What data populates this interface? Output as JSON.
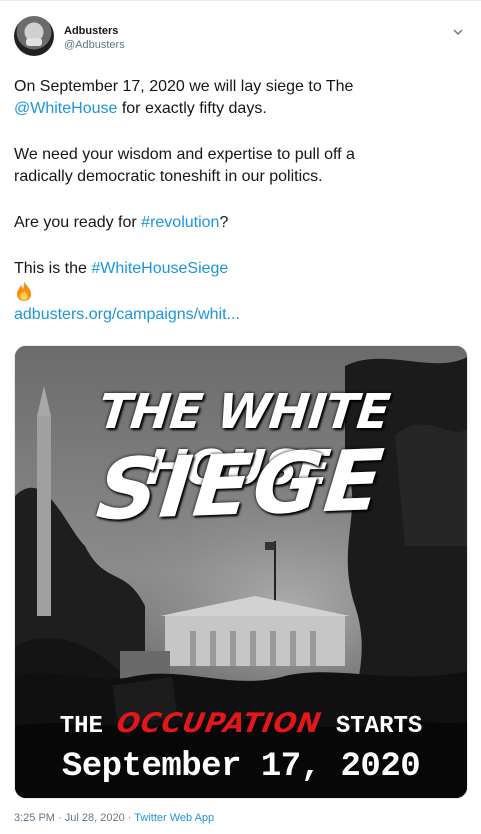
{
  "author": {
    "name": "Adbusters",
    "handle": "@Adbusters"
  },
  "tweet": {
    "line1a": "On September 17, 2020 we will lay siege to The",
    "mention": "@WhiteHouse",
    "line1b": " for exactly fifty days.",
    "para2": "We need your wisdom and expertise to pull off a radically democratic toneshift in our politics.",
    "para3a": "Are you ready for ",
    "hashtag1": "#revolution",
    "para3b": "?",
    "para4a": "This is the ",
    "hashtag2": "#WhiteHouseSiege",
    "link": "adbusters.org/campaigns/whit..."
  },
  "media": {
    "title_line1": "THE WHITE HOUSE",
    "title_line2": "SIEGE",
    "starts_the": "THE",
    "starts_occupation": "OCCUPATION",
    "starts_word": "STARTS",
    "date": "September 17, 2020"
  },
  "footer": {
    "time": "3:25 PM",
    "separator1": " · ",
    "date": "Jul 28, 2020",
    "separator2": " · ",
    "client": "Twitter Web App"
  },
  "colors": {
    "link": "#1b95e0",
    "text": "#14171a",
    "muted": "#657786",
    "occupation_red": "#e3171b"
  },
  "icons": {
    "menu": "chevron-down-icon",
    "emoji": "fire-emoji-icon",
    "avatar": "avatar"
  }
}
